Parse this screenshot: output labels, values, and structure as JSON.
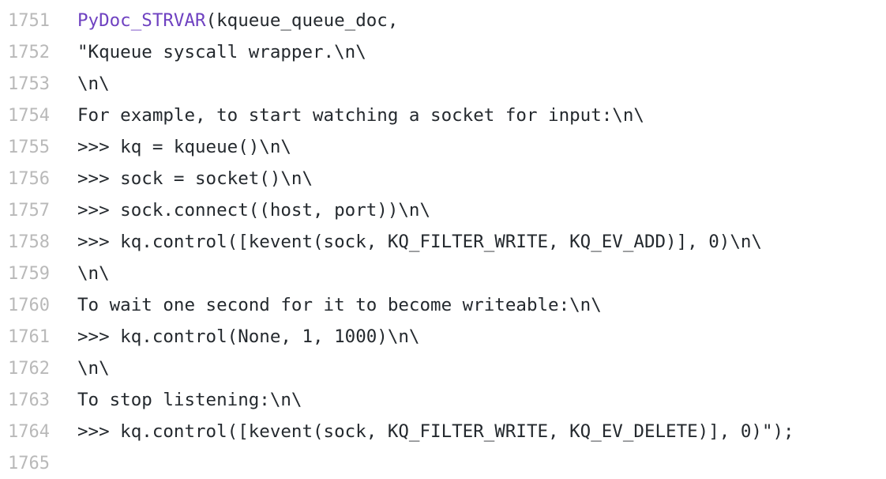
{
  "colors": {
    "line_number": "#b9b9b9",
    "text": "#24292e",
    "macro": "#6f42c1",
    "background": "#ffffff"
  },
  "lines": [
    {
      "number": "1751",
      "macro": "PyDoc_STRVAR",
      "code": "(kqueue_queue_doc,"
    },
    {
      "number": "1752",
      "macro": "",
      "code": "\"Kqueue syscall wrapper.\\n\\"
    },
    {
      "number": "1753",
      "macro": "",
      "code": "\\n\\"
    },
    {
      "number": "1754",
      "macro": "",
      "code": "For example, to start watching a socket for input:\\n\\"
    },
    {
      "number": "1755",
      "macro": "",
      "code": ">>> kq = kqueue()\\n\\"
    },
    {
      "number": "1756",
      "macro": "",
      "code": ">>> sock = socket()\\n\\"
    },
    {
      "number": "1757",
      "macro": "",
      "code": ">>> sock.connect((host, port))\\n\\"
    },
    {
      "number": "1758",
      "macro": "",
      "code": ">>> kq.control([kevent(sock, KQ_FILTER_WRITE, KQ_EV_ADD)], 0)\\n\\"
    },
    {
      "number": "1759",
      "macro": "",
      "code": "\\n\\"
    },
    {
      "number": "1760",
      "macro": "",
      "code": "To wait one second for it to become writeable:\\n\\"
    },
    {
      "number": "1761",
      "macro": "",
      "code": ">>> kq.control(None, 1, 1000)\\n\\"
    },
    {
      "number": "1762",
      "macro": "",
      "code": "\\n\\"
    },
    {
      "number": "1763",
      "macro": "",
      "code": "To stop listening:\\n\\"
    },
    {
      "number": "1764",
      "macro": "",
      "code": ">>> kq.control([kevent(sock, KQ_FILTER_WRITE, KQ_EV_DELETE)], 0)\");"
    },
    {
      "number": "1765",
      "macro": "",
      "code": ""
    }
  ]
}
